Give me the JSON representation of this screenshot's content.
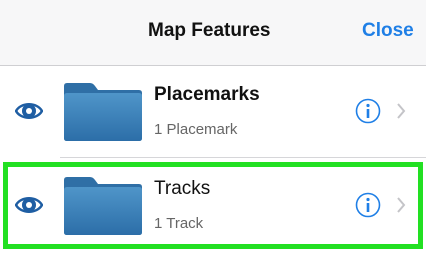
{
  "navbar": {
    "title": "Map Features",
    "close_label": "Close",
    "accent_color": "#1f7fe6"
  },
  "rows": [
    {
      "title": "Placemarks",
      "subtitle": "1 Placemark",
      "visibility_icon": "eye-icon",
      "folder_icon": "folder-icon",
      "info_icon": "info-icon",
      "chevron_icon": "chevron-right-icon"
    },
    {
      "title": "Tracks",
      "subtitle": "1 Track",
      "visibility_icon": "eye-icon",
      "folder_icon": "folder-icon",
      "info_icon": "info-icon",
      "chevron_icon": "chevron-right-icon",
      "highlighted": true
    }
  ],
  "colors": {
    "highlight": "#22e022",
    "folder": "#3a7fb6",
    "eye": "#1f5ea3"
  }
}
